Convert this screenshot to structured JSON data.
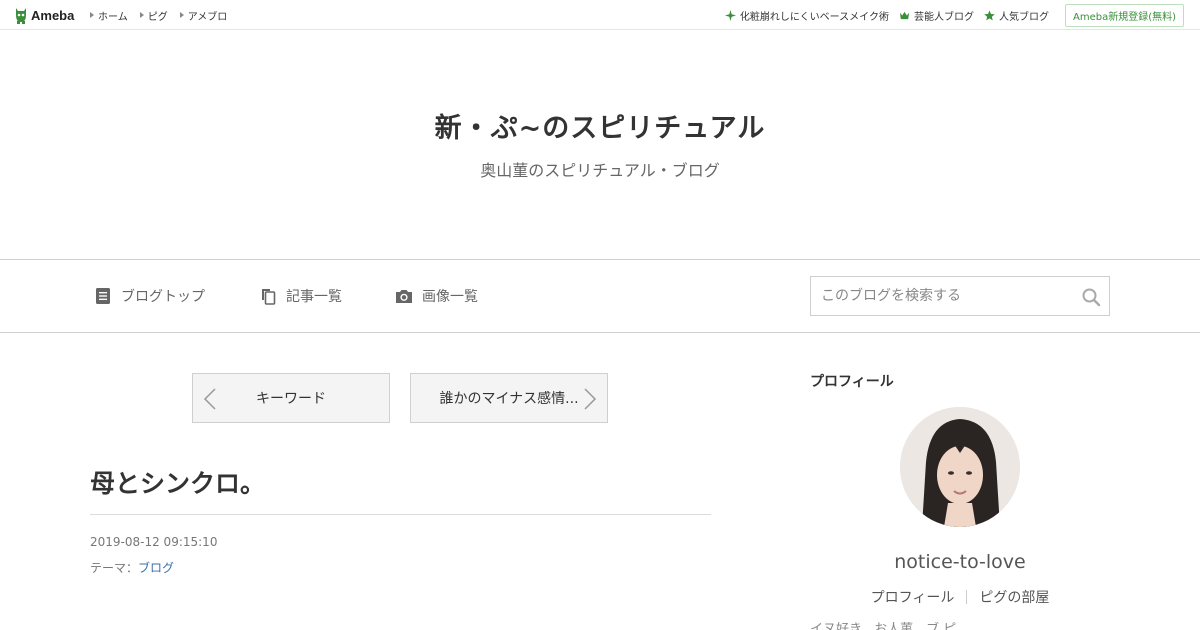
{
  "topbar": {
    "logo_text": "Ameba",
    "nav": [
      {
        "label": "ホーム"
      },
      {
        "label": "ピグ"
      },
      {
        "label": "アメブロ"
      }
    ],
    "right": [
      {
        "icon": "sparkle-icon",
        "label": "化粧崩れしにくいベースメイク術"
      },
      {
        "icon": "crown-icon",
        "label": "芸能人ブログ"
      },
      {
        "icon": "star-icon",
        "label": "人気ブログ"
      }
    ],
    "register_label": "Ameba新規登録(無料)",
    "accent_color": "#3a8f3a"
  },
  "header": {
    "title": "新・ぷ~のスピリチュアル",
    "subtitle": "奥山菫のスピリチュアル・ブログ"
  },
  "nav": {
    "items": [
      {
        "icon": "document-icon",
        "label": "ブログトップ"
      },
      {
        "icon": "copy-icon",
        "label": "記事一覧"
      },
      {
        "icon": "camera-icon",
        "label": "画像一覧"
      }
    ],
    "search_placeholder": "このブログを検索する"
  },
  "pager": {
    "prev_label": "キーワード",
    "next_label": "誰かのマイナス感情..."
  },
  "post": {
    "title": "母とシンクロ。",
    "date": "2019-08-12 09:15:10",
    "theme_prefix": "テーマ：",
    "theme_link": "ブログ",
    "link_color": "#3b6ea8"
  },
  "sidebar": {
    "heading": "プロフィール",
    "name": "notice-to-love",
    "links": [
      {
        "label": "プロフィール"
      },
      {
        "label": "ピグの部屋"
      }
    ],
    "cut_text": "イヌ好き、お人菫、ブ ピ"
  }
}
